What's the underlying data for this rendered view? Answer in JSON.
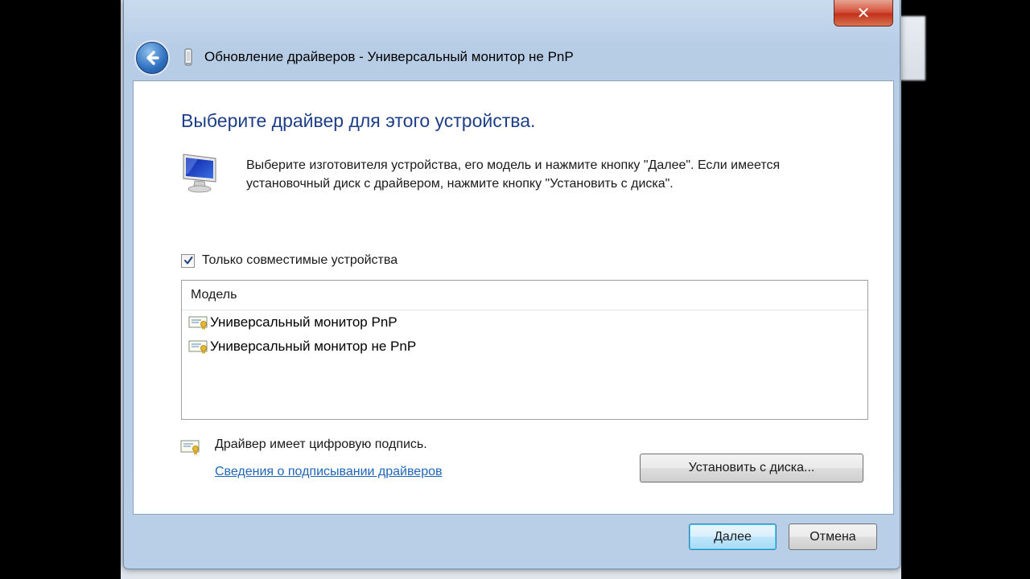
{
  "window": {
    "title": "Обновление драйверов - Универсальный монитор не PnP",
    "close_glyph": "✕"
  },
  "page": {
    "heading": "Выберите драйвер для этого устройства.",
    "description_line1": "Выберите изготовителя устройства, его модель и нажмите кнопку \"Далее\". Если имеется",
    "description_line2": "установочный диск с  драйвером, нажмите кнопку \"Установить с диска\"."
  },
  "filter": {
    "label": "Только совместимые устройства",
    "checked": true
  },
  "model_list": {
    "header": "Модель",
    "items": [
      {
        "label": "Универсальный монитор PnP"
      },
      {
        "label": "Универсальный монитор не PnP"
      }
    ]
  },
  "signature": {
    "status": "Драйвер имеет цифровую подпись.",
    "link": "Сведения о подписывании драйверов"
  },
  "buttons": {
    "have_disk": "Установить с диска...",
    "next": "Далее",
    "cancel": "Отмена"
  },
  "icons": {
    "back": "back-arrow-icon",
    "device": "device-icon",
    "monitor": "monitor-icon",
    "certificate": "certificate-icon",
    "checkmark": "checkmark-icon"
  },
  "colors": {
    "heading": "#1e3f87",
    "link": "#1f66b8",
    "close_button": "#c2311b",
    "frame": "#b9cfe7"
  }
}
